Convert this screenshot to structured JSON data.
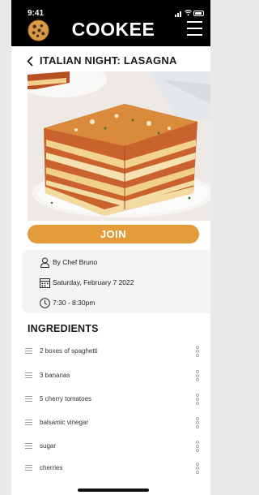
{
  "status": {
    "time": "9:41"
  },
  "header": {
    "brand": "COOKEE",
    "logo_icon": "cookie-icon",
    "menu_icon": "hamburger-menu-icon"
  },
  "event": {
    "back_icon": "chevron-left-icon",
    "title": "ITALIAN NIGHT: LASAGNA",
    "image_alt": "Slice of lasagna on a plate",
    "join_label": "JOIN",
    "host": "By Chef Bruno",
    "date": "Saturday, February 7 2022",
    "time": "7:30 - 8:30pm"
  },
  "ingredients": {
    "title": "INGREDIENTS",
    "items": [
      {
        "name": "2 boxes of spaghetti"
      },
      {
        "name": "3 bananas"
      },
      {
        "name": "5 cherry tomatoes"
      },
      {
        "name": "balsamic vinegar"
      },
      {
        "name": "sugar"
      },
      {
        "name": "cherries"
      }
    ]
  },
  "colors": {
    "accent": "#E49B39",
    "header_bg": "#000000",
    "card_bg": "#F4F4F4"
  }
}
